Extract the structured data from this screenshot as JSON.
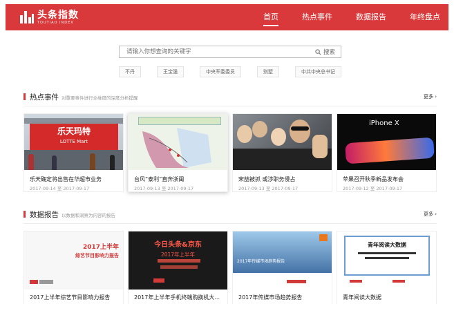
{
  "header": {
    "logo_cn": "头条指数",
    "logo_en": "TOUTIAO INDEX",
    "nav": [
      "首页",
      "热点事件",
      "数据报告",
      "年终盘点"
    ]
  },
  "search": {
    "placeholder": "请输入你想查询的关键字",
    "button": "搜索"
  },
  "tags": [
    "不丹",
    "王宝强",
    "中央军委委员",
    "别墅",
    "中共中央总书记"
  ],
  "hot": {
    "title": "热点事件",
    "subtitle": "对重要事件进行全维度的深度分析提醒",
    "more": "更多",
    "items": [
      {
        "title": "乐天确定将出售在华超市业务",
        "date": "2017-09-14 至 2017-09-17",
        "thumb_text": "乐天玛特",
        "thumb_sub": "LOTTE Mart"
      },
      {
        "title": "台风“泰利”直奔浙闽",
        "date": "2017-09-13 至 2017-09-17",
        "thumb_text": "",
        "thumb_sub": ""
      },
      {
        "title": "宋喆被抓 或涉职务侵占",
        "date": "2017-09-13 至 2017-09-17",
        "thumb_text": "",
        "thumb_sub": ""
      },
      {
        "title": "苹果召开秋季新品发布会",
        "date": "2017-09-12 至 2017-09-17",
        "thumb_text": "iPhone X",
        "thumb_sub": ""
      }
    ]
  },
  "reports": {
    "title": "数据报告",
    "subtitle": "以数据和洞察为内容的报告",
    "more": "更多",
    "items": [
      {
        "title": "2017上半年综艺节目影响力报告",
        "thumb_line1": "2017上半年",
        "thumb_line2": "综艺节目影响力报告"
      },
      {
        "title": "2017年上半年手机终端购换机大...",
        "thumb_line1": "今日头条&京东",
        "thumb_line2": "2017年上半年"
      },
      {
        "title": "2017年传媒市场趋势报告",
        "thumb_line1": "2017年传媒市场趋势报告",
        "thumb_line2": ""
      },
      {
        "title": "青年阅读大数据",
        "thumb_line1": "青年阅读大数据",
        "thumb_line2": ""
      }
    ]
  },
  "colors": {
    "brand": "#d9393b"
  }
}
